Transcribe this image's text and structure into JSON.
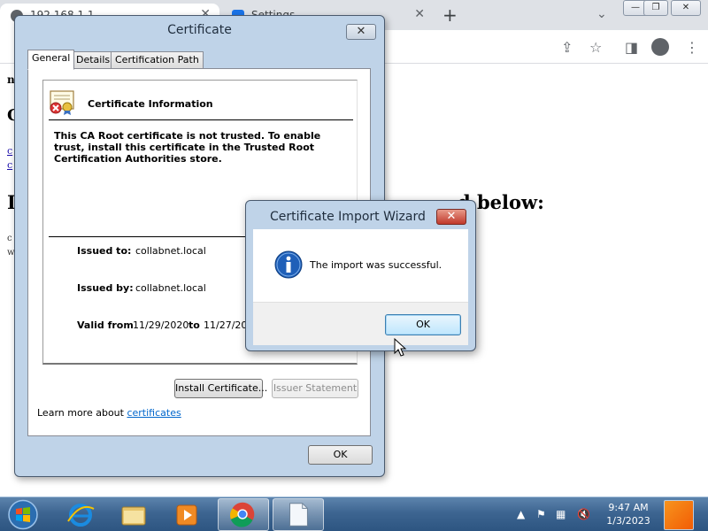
{
  "browser": {
    "tabs": [
      {
        "title": "192.168.1.1"
      },
      {
        "title": "Settings"
      }
    ],
    "new_tab_glyph": "+",
    "window_controls": {
      "minimize": "—",
      "restore": "❐",
      "close": "✕"
    },
    "toolbar_icons": [
      "share-icon",
      "star-icon",
      "side-panel-icon",
      "profile-icon",
      "menu-icon"
    ]
  },
  "page": {
    "heading_tail": "d below:"
  },
  "certificate_dialog": {
    "title": "Certificate",
    "close_glyph": "✕",
    "tabs": [
      "General",
      "Details",
      "Certification Path"
    ],
    "info_heading": "Certificate Information",
    "message": "This CA Root certificate is not trusted. To enable trust, install this certificate in the Trusted Root Certification Authorities store.",
    "issued_to_label": "Issued to:",
    "issued_to_value": "collabnet.local",
    "issued_by_label": "Issued by:",
    "issued_by_value": "collabnet.local",
    "valid_from_label": "Valid from",
    "valid_from_value": "11/29/2020",
    "valid_to_label": "to",
    "valid_to_value": "11/27/203",
    "install_button": "Install Certificate...",
    "issuer_button": "Issuer Statement",
    "learn_prefix": "Learn more about",
    "learn_link": "certificates",
    "ok_button": "OK"
  },
  "import_wizard": {
    "title": "Certificate Import Wizard",
    "close_glyph": "✕",
    "message": "The import was successful.",
    "ok_button": "OK"
  },
  "taskbar": {
    "pinned": [
      "internet-explorer-icon",
      "file-explorer-icon",
      "media-player-icon",
      "chrome-icon",
      "document-icon"
    ],
    "tray_icons": [
      "show-hidden-icons-icon",
      "action-center-flag-icon",
      "network-icon",
      "volume-muted-icon"
    ],
    "time": "9:47 AM",
    "date": "1/3/2023"
  },
  "colors": {
    "dialog_frame": "#bfd3e8",
    "link": "#0066cc",
    "taskbar": "#3d6591",
    "wizard_close": "#c0392b"
  }
}
